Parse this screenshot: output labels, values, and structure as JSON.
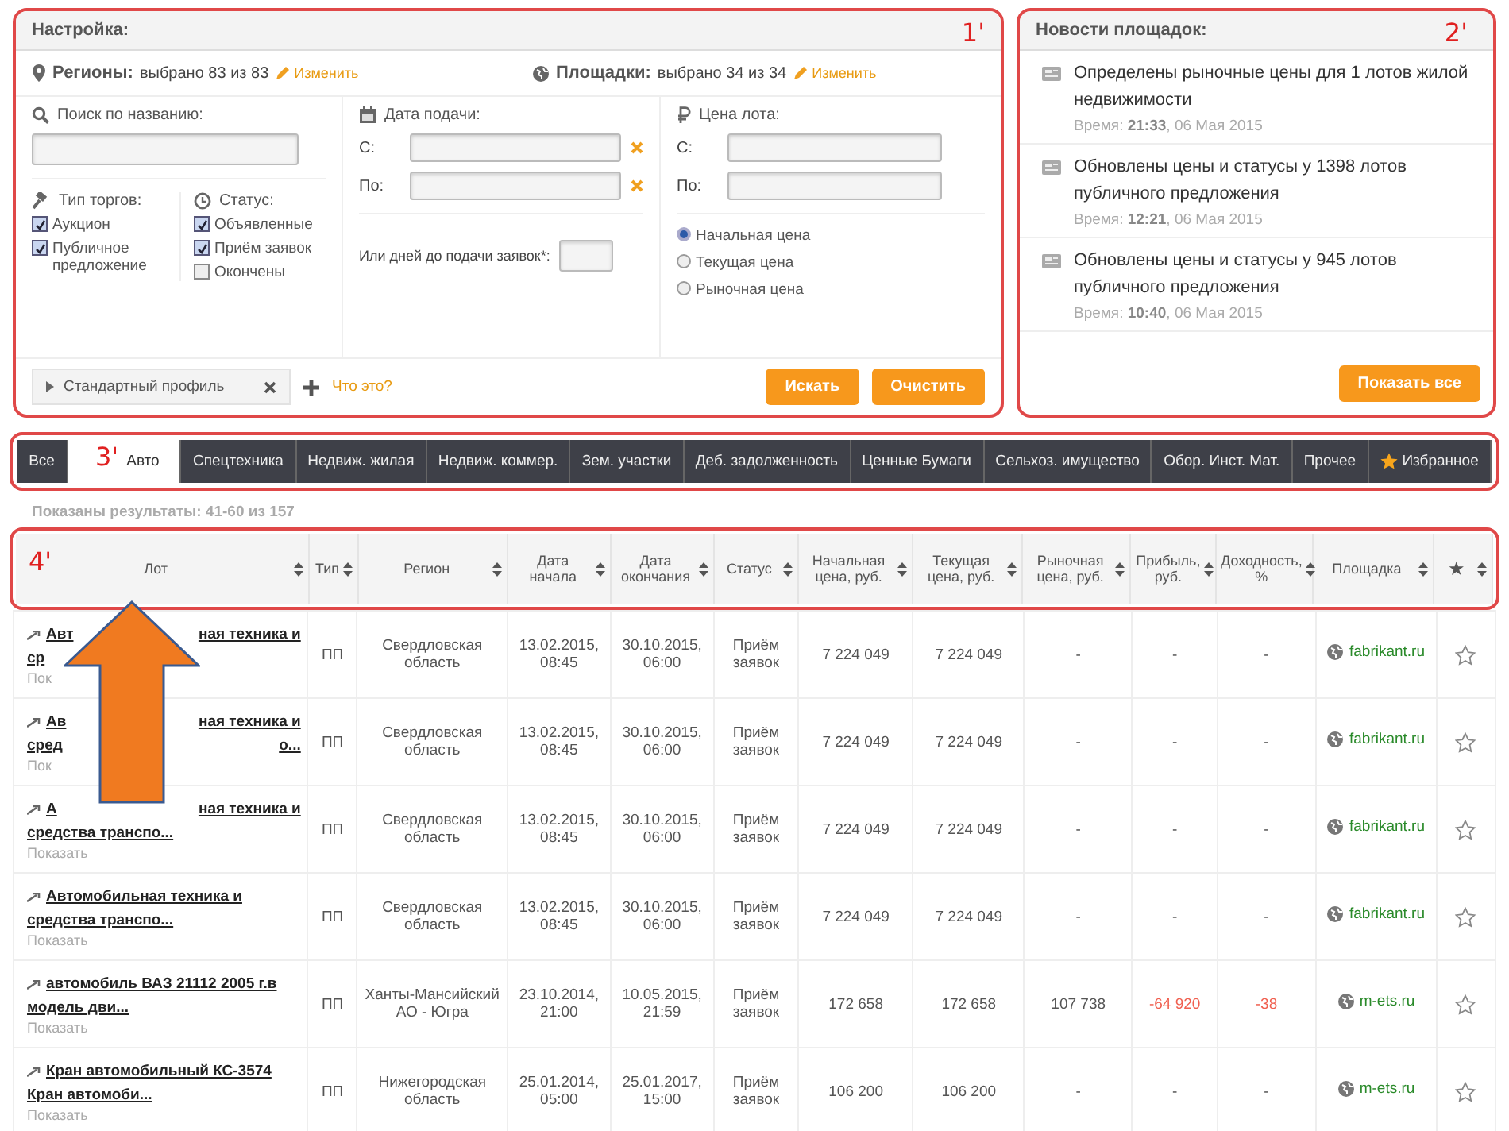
{
  "settings": {
    "title": "Настройка:",
    "annotation": "1'",
    "regions": {
      "label": "Регионы:",
      "value": "выбрано 83 из 83",
      "link": "Изменить"
    },
    "platforms": {
      "label": "Площадки:",
      "value": "выбрано 34 из 34",
      "link": "Изменить"
    },
    "search": {
      "label": "Поиск по названию:"
    },
    "trade_type": {
      "label": "Тип торгов:",
      "options": [
        {
          "label": "Аукцион",
          "checked": true
        },
        {
          "label": "Публичное предложение",
          "checked": true
        }
      ]
    },
    "status": {
      "label": "Статус:",
      "options": [
        {
          "label": "Объявленные",
          "checked": true
        },
        {
          "label": "Приём заявок",
          "checked": true
        },
        {
          "label": "Окончены",
          "checked": false
        }
      ]
    },
    "date": {
      "label": "Дата подачи:",
      "from_label": "С:",
      "to_label": "По:",
      "days_label": "Или дней до подачи заявок*:"
    },
    "price": {
      "label": "Цена лота:",
      "from_label": "С:",
      "to_label": "По:",
      "options": [
        {
          "label": "Начальная цена",
          "selected": true
        },
        {
          "label": "Текущая цена",
          "selected": false
        },
        {
          "label": "Рыночная цена",
          "selected": false
        }
      ]
    },
    "profile": {
      "value": "Стандартный профиль"
    },
    "help_link": "Что это?",
    "buttons": [
      "Искать",
      "Очистить"
    ]
  },
  "news": {
    "title": "Новости площадок:",
    "annotation": "2'",
    "items": [
      {
        "text": "Определены рыночные цены для 1 лотов жилой недвижимости",
        "time": "Время: **21:33**, 06 Мая 2015"
      },
      {
        "text": "Обновлены цены и статусы у 1398 лотов публичного предложения",
        "time": "Время: **12:21**, 06 Мая 2015"
      },
      {
        "text": "Обновлены цены и статусы у 945 лотов публичного предложения",
        "time": "Время: **10:40**, 06 Мая 2015"
      }
    ],
    "button": "Показать все"
  },
  "tabs_annotation": "3'",
  "tabs": [
    {
      "label": "Все",
      "selected": false,
      "kind": "plain"
    },
    {
      "label": "Авто",
      "selected": true,
      "kind": "plain"
    },
    {
      "label": "Спецтехника",
      "selected": false,
      "kind": "plain"
    },
    {
      "label": "Недвиж. жилая",
      "selected": false,
      "kind": "plain"
    },
    {
      "label": "Недвиж. коммер.",
      "selected": false,
      "kind": "plain"
    },
    {
      "label": "Зем. участки",
      "selected": false,
      "kind": "plain"
    },
    {
      "label": "Деб. задолженность",
      "selected": false,
      "kind": "plain"
    },
    {
      "label": "Ценные Бумаги",
      "selected": false,
      "kind": "plain"
    },
    {
      "label": "Сельхоз. имущество",
      "selected": false,
      "kind": "plain"
    },
    {
      "label": "Обор. Инст. Мат.",
      "selected": false,
      "kind": "plain"
    },
    {
      "label": "Прочее",
      "selected": false,
      "kind": "plain"
    },
    {
      "label": "Избранное",
      "selected": false,
      "kind": "starred"
    }
  ],
  "results": "Показаны результаты: 41-60 из 157",
  "table": {
    "annotation": "4'",
    "columns": [
      "Лот",
      "Тип",
      "Регион",
      "Дата начала",
      "Дата окончания",
      "Статус",
      "Начальная цена, руб.",
      "Текущая цена, руб.",
      "Рыночная цена, руб.",
      "Прибыль, руб.",
      "Доходность, %",
      "Площадка",
      "★"
    ],
    "rows": [
      {
        "lot_lines": [
          [
            "Авт",
            "ная техника и"
          ],
          [
            "ср"
          ]
        ],
        "show": "Пок",
        "type": "ПП",
        "region": "Свердловская область",
        "start": "13.02.2015, 08:45",
        "end": "30.10.2015, 06:00",
        "status": "Приём заявок",
        "initial": "7 224 049",
        "current": "7 224 049",
        "market": "-",
        "profit": "-",
        "yield": "-",
        "loss": false,
        "platform": "fabrikant.ru"
      },
      {
        "lot_lines": [
          [
            "Ав",
            "ная техника и"
          ],
          [
            "сред",
            "о..."
          ]
        ],
        "show": "Пок",
        "type": "ПП",
        "region": "Свердловская область",
        "start": "13.02.2015, 08:45",
        "end": "30.10.2015, 06:00",
        "status": "Приём заявок",
        "initial": "7 224 049",
        "current": "7 224 049",
        "market": "-",
        "profit": "-",
        "yield": "-",
        "loss": false,
        "platform": "fabrikant.ru"
      },
      {
        "lot_lines": [
          [
            "А",
            "ная техника и"
          ],
          [
            "средства транспо..."
          ]
        ],
        "show": "Показать",
        "type": "ПП",
        "region": "Свердловская область",
        "start": "13.02.2015, 08:45",
        "end": "30.10.2015, 06:00",
        "status": "Приём заявок",
        "initial": "7 224 049",
        "current": "7 224 049",
        "market": "-",
        "profit": "-",
        "yield": "-",
        "loss": false,
        "platform": "fabrikant.ru"
      },
      {
        "lot_lines": [
          [
            "Автомобильная техника и"
          ],
          [
            "средства транспо..."
          ]
        ],
        "show": "Показать",
        "type": "ПП",
        "region": "Свердловская область",
        "start": "13.02.2015, 08:45",
        "end": "30.10.2015, 06:00",
        "status": "Приём заявок",
        "initial": "7 224 049",
        "current": "7 224 049",
        "market": "-",
        "profit": "-",
        "yield": "-",
        "loss": false,
        "platform": "fabrikant.ru"
      },
      {
        "lot_lines": [
          [
            "автомобиль ВАЗ 21112 2005 г.в"
          ],
          [
            "модель дви..."
          ]
        ],
        "show": "Показать",
        "type": "ПП",
        "region": "Ханты-Мансийский АО - Югра",
        "start": "23.10.2014, 21:00",
        "end": "10.05.2015, 21:59",
        "status": "Приём заявок",
        "initial": "172 658",
        "current": "172 658",
        "market": "107 738",
        "profit": "-64 920",
        "yield": "-38",
        "loss": true,
        "platform": "m-ets.ru"
      },
      {
        "lot_lines": [
          [
            "Кран автомобильный КС-3574"
          ],
          [
            "Кран автомоби..."
          ]
        ],
        "show": "Показать",
        "type": "ПП",
        "region": "Нижегородская область",
        "start": "25.01.2014, 05:00",
        "end": "25.01.2017, 15:00",
        "status": "Приём заявок",
        "initial": "106 200",
        "current": "106 200",
        "market": "-",
        "profit": "-",
        "yield": "-",
        "loss": false,
        "platform": "m-ets.ru"
      }
    ]
  }
}
